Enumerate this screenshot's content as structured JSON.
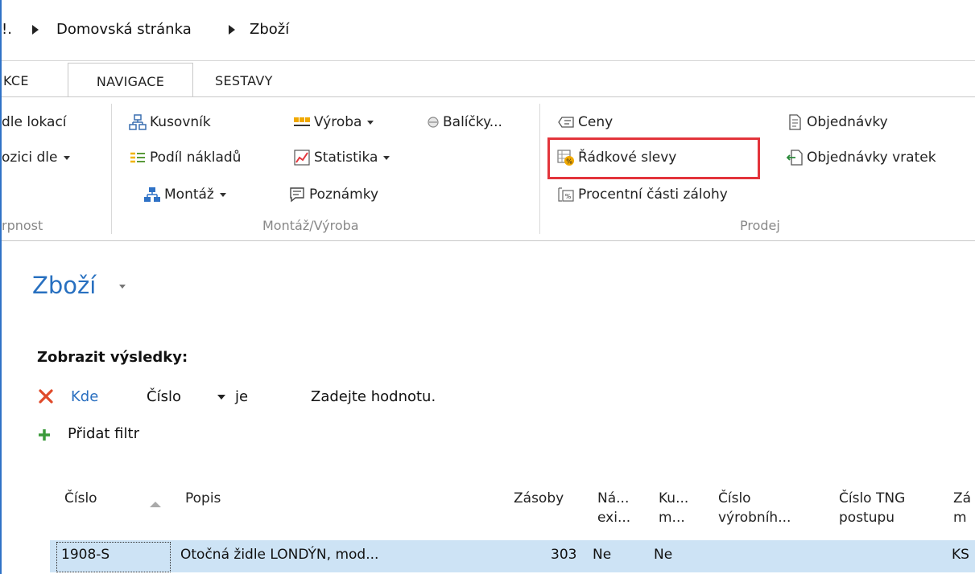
{
  "breadcrumb": {
    "leading": "!.",
    "items": [
      "Domovská stránka",
      "Zboží"
    ]
  },
  "tabs": [
    "KCE",
    "NAVIGACE",
    "SESTAVY"
  ],
  "ribbon": {
    "groups": {
      "left": {
        "label": "rpnost",
        "items": [
          "dle lokací",
          "ozici dle"
        ]
      },
      "montaz_vyroba": {
        "label": "Montáž/Výroba",
        "items": {
          "kusovnik": "Kusovník",
          "podil": "Podíl nákladů",
          "montaz": "Montáž",
          "vyroba": "Výroba",
          "statistika": "Statistika",
          "poznamky": "Poznámky",
          "balicky": "Balíčky..."
        }
      },
      "prodej": {
        "label": "Prodej",
        "items": {
          "ceny": "Ceny",
          "radkove_slevy": "Řádkové slevy",
          "procentni": "Procentní části zálohy",
          "objednavky": "Objednávky",
          "objednavky_vratek": "Objednávky vratek"
        }
      }
    }
  },
  "page_title": "Zboží",
  "filter": {
    "heading": "Zobrazit výsledky:",
    "where": "Kde",
    "field": "Číslo",
    "operator": "je",
    "value": "Zadejte hodnotu.",
    "add_filter": "Přidat filtr"
  },
  "table": {
    "columns": [
      {
        "line1": "Číslo",
        "line2": ""
      },
      {
        "line1": "Popis",
        "line2": ""
      },
      {
        "line1": "Zásoby",
        "line2": ""
      },
      {
        "line1": "Ná...",
        "line2": "exi..."
      },
      {
        "line1": "Ku...",
        "line2": "m..."
      },
      {
        "line1": "Číslo",
        "line2": "výrobníh..."
      },
      {
        "line1": "Číslo TNG",
        "line2": "postupu"
      },
      {
        "line1": "Zá",
        "line2": "m"
      }
    ],
    "rows": [
      {
        "cislo": "1908-S",
        "popis": "Otočná židle LONDÝN, mod...",
        "zasoby": "303",
        "na": "Ne",
        "ku": "Ne",
        "last": "KS"
      }
    ]
  },
  "colors": {
    "accent": "#2870c0",
    "highlight": "#e3343b",
    "selected_row": "#cde3f5"
  }
}
